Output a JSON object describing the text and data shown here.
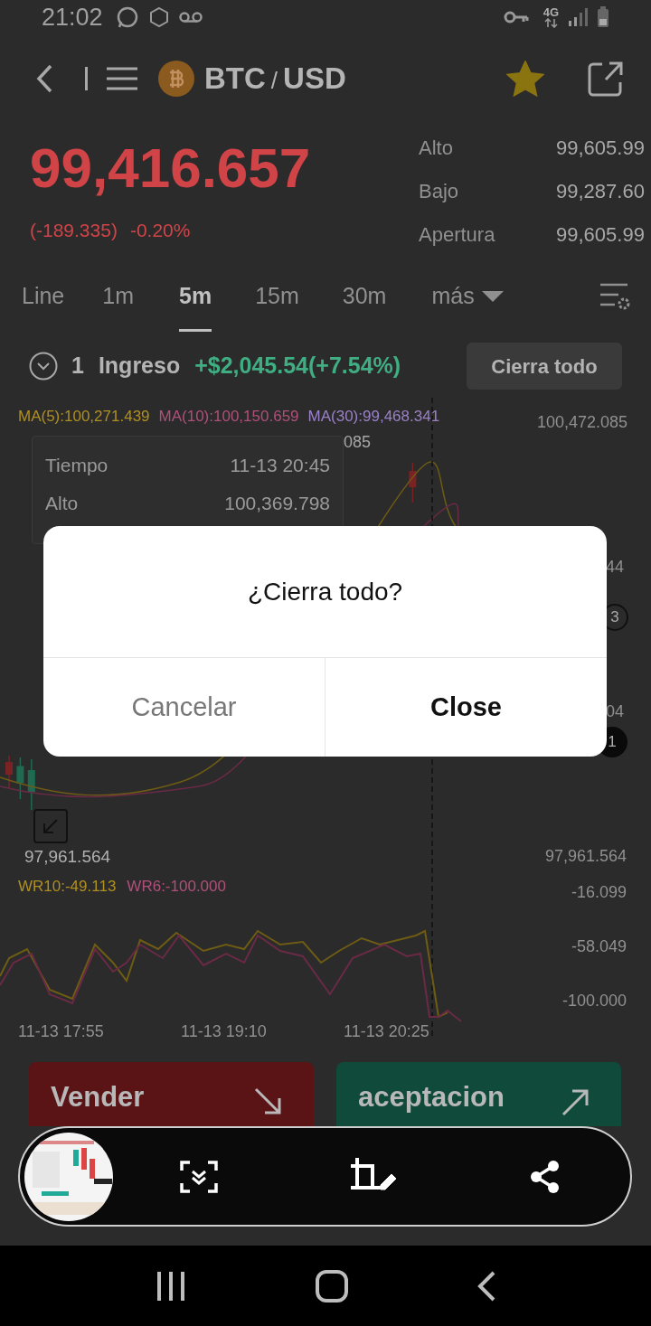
{
  "status_bar": {
    "time": "21:02",
    "network": "4G"
  },
  "header": {
    "base": "BTC",
    "separator": "/",
    "quote": "USD",
    "favorite": true
  },
  "quote": {
    "price": "99,416.657",
    "change": "(-189.335)",
    "change_percent": "-0.20%",
    "stats": [
      {
        "label": "Alto",
        "value": "99,605.99"
      },
      {
        "label": "Bajo",
        "value": "99,287.60"
      },
      {
        "label": "Apertura",
        "value": "99,605.99"
      }
    ]
  },
  "timeframes": [
    {
      "label": "Line",
      "selected": false
    },
    {
      "label": "1m",
      "selected": false
    },
    {
      "label": "5m",
      "selected": true
    },
    {
      "label": "15m",
      "selected": false
    },
    {
      "label": "30m",
      "selected": false
    },
    {
      "label": "más",
      "selected": false,
      "kind": "dropdown"
    }
  ],
  "position": {
    "count": "1",
    "label": "Ingreso",
    "profit": "+$2,045.54(+7.54%)",
    "close_all_button": "Cierra todo"
  },
  "chart": {
    "ma": [
      {
        "label": "MA(5):100,271.439",
        "color": "#b09020"
      },
      {
        "label": "MA(10):100,150.659",
        "color": "#b0507a"
      },
      {
        "label": "MA(30):99,468.341",
        "color": "#9a80c8"
      }
    ],
    "axis_high": "100,472.085",
    "high_marker": "085",
    "tooltip": [
      {
        "label": "Tiempo",
        "value": "11-13 20:45"
      },
      {
        "label": "Alto",
        "value": "100,369.798"
      }
    ],
    "axis_partial": [
      "44",
      "04"
    ],
    "price_tags": [
      "3",
      "1"
    ],
    "low_marker": "97,961.564",
    "axis_low": "97,961.564",
    "wr": [
      {
        "label": "WR10:-49.113",
        "color": "#b09020"
      },
      {
        "label": "WR6:-100.000",
        "color": "#b0507a"
      }
    ],
    "wr_axis": [
      "-16.099",
      "-58.049",
      "-100.000"
    ],
    "time_axis": [
      "11-13 17:55",
      "11-13 19:10",
      "11-13 20:25"
    ]
  },
  "trade_buttons": [
    {
      "kind": "sell",
      "label": "Vender"
    },
    {
      "kind": "buy",
      "label": "aceptacion"
    }
  ],
  "dialog": {
    "title": "¿Cierra todo?",
    "buttons": [
      {
        "kind": "cancel",
        "label": "Cancelar"
      },
      {
        "kind": "confirm",
        "label": "Close"
      }
    ]
  }
}
